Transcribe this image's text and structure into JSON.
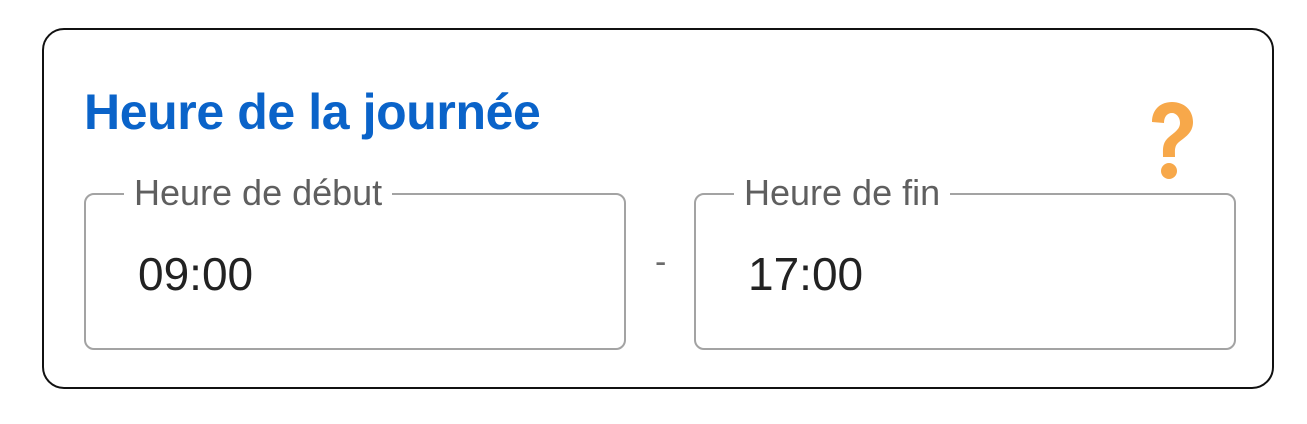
{
  "time_of_day": {
    "title": "Heure de la journée",
    "help_icon": "question-mark-icon",
    "accent_color": "#0a63c9",
    "help_color": "#f7a84a",
    "start_field": {
      "label": "Heure de début",
      "value": "09:00"
    },
    "separator": "-",
    "end_field": {
      "label": "Heure de fin",
      "value": "17:00"
    }
  }
}
